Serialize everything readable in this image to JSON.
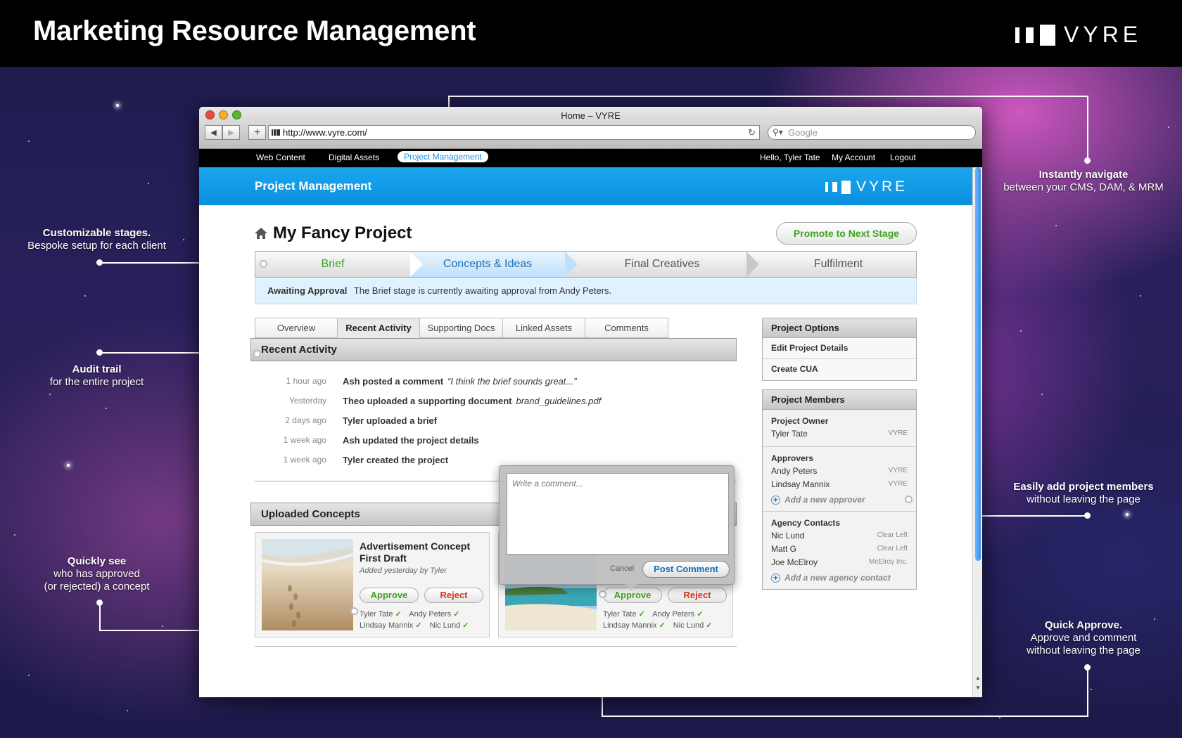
{
  "banner": {
    "title": "Marketing Resource Management",
    "brand_word": "VYRE"
  },
  "annotations": {
    "navigate": {
      "title": "Instantly navigate",
      "text": "between your CMS, DAM, & MRM"
    },
    "stages": {
      "title": "Customizable stages.",
      "text": "Bespoke setup for each client"
    },
    "audit": {
      "title": "Audit trail",
      "text": "for the entire project"
    },
    "members": {
      "title": "Easily add project members",
      "text": "without leaving the page"
    },
    "quicksee": {
      "title": "Quickly see",
      "line2": "who has approved",
      "line3": "(or rejected) a concept"
    },
    "quickapprove": {
      "title": "Quick Approve.",
      "line2": "Approve and comment",
      "line3": "without leaving the page"
    }
  },
  "browser": {
    "window_title": "Home – VYRE",
    "url": "http://www.vyre.com/",
    "search_placeholder": "Google"
  },
  "app_nav": {
    "items": [
      "Web Content",
      "Digital Assets",
      "Project Management"
    ],
    "active": "Project Management",
    "greeting": "Hello, Tyler Tate",
    "account": "My Account",
    "logout": "Logout"
  },
  "app_bar": {
    "title": "Project Management",
    "brand_word": "VYRE"
  },
  "project": {
    "title": "My Fancy Project",
    "promote_label": "Promote to Next Stage",
    "stages": [
      "Brief",
      "Concepts & Ideas",
      "Final Creatives",
      "Fulfilment"
    ],
    "notice_status": "Awaiting Approval",
    "notice_text": "The Brief stage is currently awaiting approval from Andy Peters."
  },
  "tabs": [
    "Overview",
    "Recent Activity",
    "Supporting Docs",
    "Linked Assets",
    "Comments"
  ],
  "active_tab": "Recent Activity",
  "recent_activity": {
    "heading": "Recent Activity",
    "items": [
      {
        "time": "1 hour ago",
        "text": "Ash posted a comment",
        "detail": "“I think the brief sounds great...”"
      },
      {
        "time": "Yesterday",
        "text": "Theo uploaded a supporting document",
        "detail": "brand_guidelines.pdf"
      },
      {
        "time": "2 days ago",
        "text": "Tyler uploaded a brief",
        "detail": ""
      },
      {
        "time": "1 week ago",
        "text": "Ash updated the project details",
        "detail": ""
      },
      {
        "time": "1 week ago",
        "text": "Tyler created the project",
        "detail": ""
      }
    ]
  },
  "uploaded_concepts": {
    "heading": "Uploaded Concepts",
    "concepts": [
      {
        "title": "Advertisement Concept First Draft",
        "subtitle": "Added yesterday by Tyler",
        "approve": "Approve",
        "reject": "Reject",
        "approvers": [
          "Tyler Tate",
          "Andy Peters",
          "Lindsay Mannix",
          "Nic Lund"
        ]
      },
      {
        "approve": "Approve",
        "reject": "Reject",
        "approvers": [
          "Tyler Tate",
          "Andy Peters",
          "Lindsay Mannix",
          "Nic Lund"
        ]
      }
    ]
  },
  "comment_popup": {
    "placeholder": "Write a comment...",
    "cancel": "Cancel",
    "post": "Post Comment"
  },
  "project_options": {
    "heading": "Project Options",
    "items": [
      "Edit Project Details",
      "Create CUA"
    ]
  },
  "project_members": {
    "heading": "Project Members",
    "owner_heading": "Project Owner",
    "owner": {
      "name": "Tyler Tate",
      "org": "VYRE"
    },
    "approvers_heading": "Approvers",
    "approvers": [
      {
        "name": "Andy Peters",
        "org": "VYRE"
      },
      {
        "name": "Lindsay Mannix",
        "org": "VYRE"
      }
    ],
    "add_approver": "Add a new approver",
    "agency_heading": "Agency Contacts",
    "agency": [
      {
        "name": "Nic Lund",
        "org": "Clear Left"
      },
      {
        "name": "Matt G",
        "org": "Clear Left"
      },
      {
        "name": "Joe McElroy",
        "org": "McElroy Inc."
      }
    ],
    "add_agency": "Add a new agency contact"
  },
  "colors": {
    "accent_blue": "#1aa6ee",
    "approve_green": "#3da41a",
    "reject_red": "#d8331b"
  }
}
